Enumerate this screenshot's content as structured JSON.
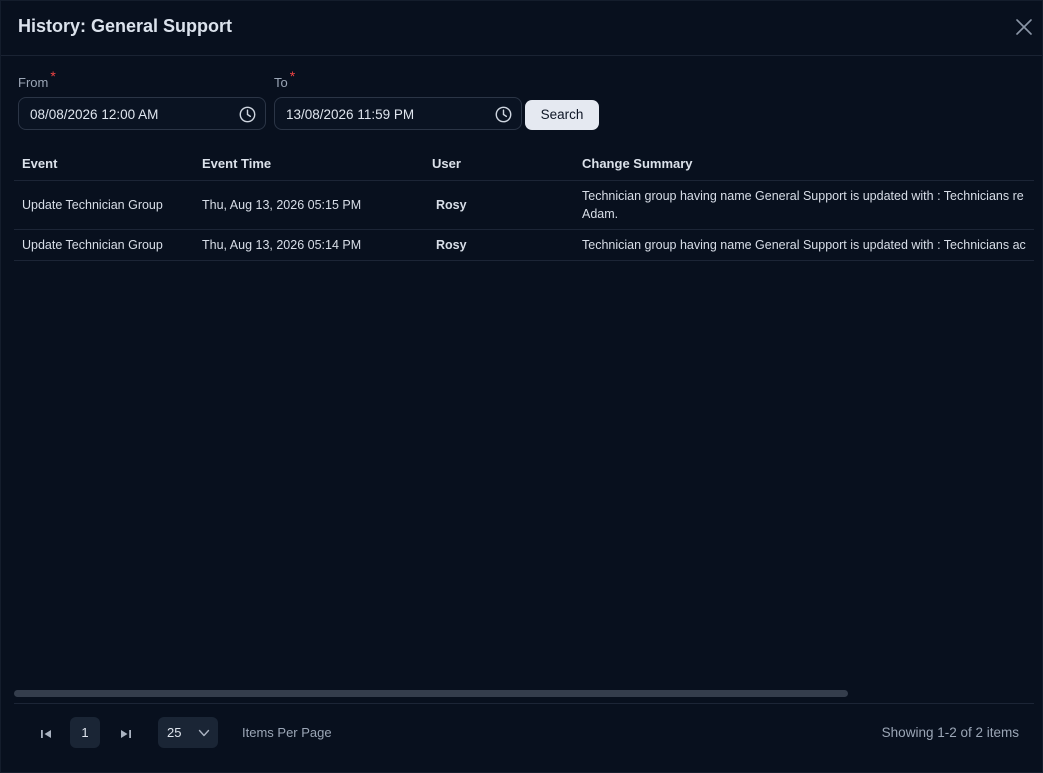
{
  "dialog": {
    "title": "History: General Support"
  },
  "filters": {
    "from_label": "From",
    "from_value": "08/08/2026 12:00 AM",
    "to_label": "To",
    "to_value": "13/08/2026 11:59 PM",
    "required_mark": "*",
    "search_label": "Search"
  },
  "table": {
    "columns": [
      "Event",
      "Event Time",
      "User",
      "Change Summary"
    ],
    "rows": [
      {
        "event": "Update Technician Group",
        "time": "Thu, Aug 13, 2026 05:15 PM",
        "user": "Rosy",
        "summary": "Technician group having name General Support is updated with : Technicians re Adam."
      },
      {
        "event": "Update Technician Group",
        "time": "Thu, Aug 13, 2026 05:14 PM",
        "user": "Rosy",
        "summary": "Technician group having name General Support is updated with : Technicians ac"
      }
    ]
  },
  "pagination": {
    "current_page": "1",
    "per_page": "25",
    "items_per_page_label": "Items Per Page",
    "showing": "Showing 1-2 of 2 items"
  },
  "icons": {
    "close": "close-icon",
    "clock": "clock-icon",
    "first": "first-page-icon",
    "last": "last-page-icon",
    "chevron": "chevron-down-icon"
  },
  "colors": {
    "background": "#08101e",
    "required": "#f04444",
    "button": "#e5e9f1"
  }
}
